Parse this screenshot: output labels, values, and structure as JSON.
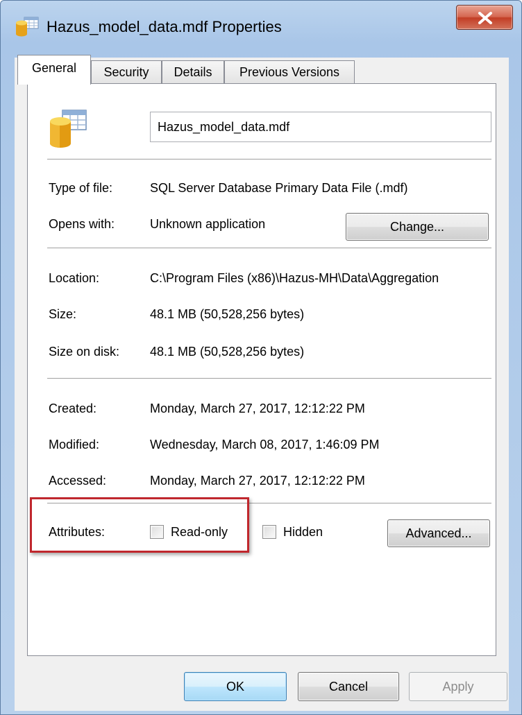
{
  "window": {
    "title": "Hazus_model_data.mdf Properties",
    "accent": "#a9c6e8",
    "close_color": "#c23d25"
  },
  "tabs": [
    {
      "label": "General",
      "active": true
    },
    {
      "label": "Security",
      "active": false
    },
    {
      "label": "Details",
      "active": false
    },
    {
      "label": "Previous Versions",
      "active": false
    }
  ],
  "general": {
    "file_name": "Hazus_model_data.mdf",
    "type_label": "Type of file:",
    "type_value": "SQL Server Database Primary Data File (.mdf)",
    "opens_label": "Opens with:",
    "opens_value": "Unknown application",
    "change_button": "Change...",
    "location_label": "Location:",
    "location_value": "C:\\Program Files (x86)\\Hazus-MH\\Data\\Aggregation",
    "size_label": "Size:",
    "size_value": "48.1 MB (50,528,256 bytes)",
    "size_disk_label": "Size on disk:",
    "size_disk_value": "48.1 MB (50,528,256 bytes)",
    "created_label": "Created:",
    "created_value": "Monday, March 27, 2017, 12:12:22 PM",
    "modified_label": "Modified:",
    "modified_value": "Wednesday, March 08, 2017, 1:46:09 PM",
    "accessed_label": "Accessed:",
    "accessed_value": "Monday, March 27, 2017, 12:12:22 PM",
    "attributes_label": "Attributes:",
    "readonly_label": "Read-only",
    "readonly_checked": false,
    "hidden_label": "Hidden",
    "hidden_checked": false,
    "advanced_button": "Advanced...",
    "highlight_color": "#c0272d"
  },
  "footer": {
    "ok": "OK",
    "cancel": "Cancel",
    "apply": "Apply"
  },
  "icons": {
    "title_icon": "database-file-icon",
    "file_icon": "database-file-icon",
    "close_icon": "close-icon"
  }
}
